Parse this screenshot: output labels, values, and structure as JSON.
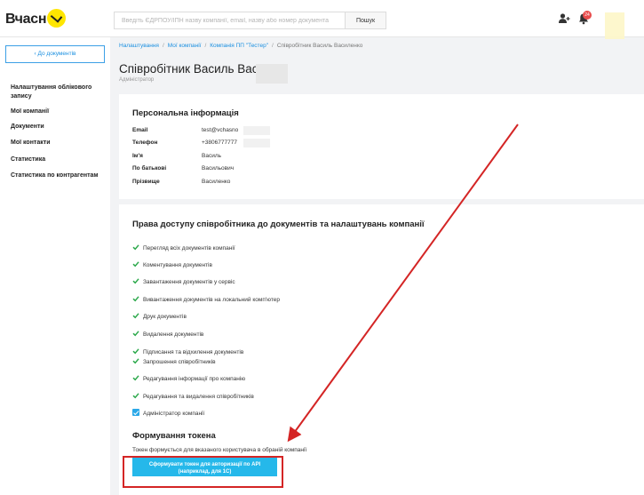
{
  "header": {
    "logo_text": "Вчасн",
    "search_placeholder": "Введіть ЄДРПОУ/ІПН назву компанії, email, назву або номер документа",
    "search_button": "Пошук",
    "notification_count": "24"
  },
  "sidebar": {
    "back_label": "До документів",
    "items": [
      "Налаштування облікового запису",
      "Мої компанії",
      "Документи",
      "Мої контакти",
      "Статистика",
      "Статистика по контрагентам"
    ]
  },
  "breadcrumb": {
    "items": [
      "Налаштування",
      "Мої компанії",
      "Компанія ПП \"Тестер\""
    ],
    "current": "Співробітник Василь Василенко"
  },
  "page": {
    "title": "Співробітник Василь Васил",
    "subtitle": "Адміністратор"
  },
  "personal": {
    "title": "Персональна інформація",
    "rows": [
      {
        "label": "Email",
        "value": "test@vchasno"
      },
      {
        "label": "Телефон",
        "value": "+3806777777"
      },
      {
        "label": "Ім'я",
        "value": "Василь"
      },
      {
        "label": "По батькові",
        "value": "Васильович"
      },
      {
        "label": "Прізвище",
        "value": "Василенко"
      }
    ]
  },
  "rights": {
    "title": "Права доступу співробітника до документів та налаштувань компанії",
    "permissions": [
      "Перегляд всіх документів компанії",
      "Коментування документів",
      "Завантаження документів у сервіс",
      "Вивантаження документів на локальний комп'ютер",
      "Друк документів",
      "Видалення документів",
      "Підписання та відхилення документів",
      "Запрошення співробітників",
      "Редагування інформації про компанію",
      "Редагування та видалення співробітників"
    ],
    "admin_label": "Адміністратор компанії"
  },
  "token": {
    "title": "Формування токена",
    "description": "Токен формується для вказаного користувача в обраній компанії",
    "button_line1": "Сформувати токен для авторизації по API",
    "button_line2": "(наприклад, для 1С)"
  },
  "colors": {
    "accent": "#1a8fe0",
    "button": "#25b8ea",
    "check": "#2aa84a",
    "annotation": "#d42525",
    "logo_yellow": "#ffe600"
  }
}
